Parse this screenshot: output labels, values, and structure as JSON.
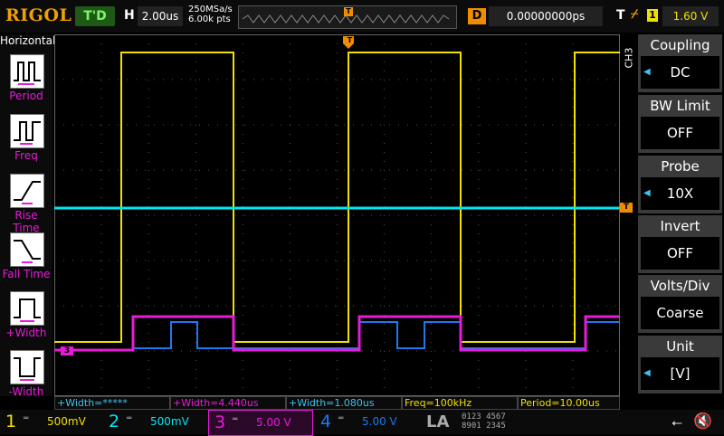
{
  "brand": "RIGOL",
  "colors": {
    "ch1": "#f0e000",
    "ch2": "#00e8f0",
    "ch3": "#e61bd8",
    "ch4": "#1e78f0",
    "trigger": "#f08c00",
    "run_state_bg": "#1e5a16"
  },
  "header": {
    "run_state": "T'D",
    "horizontal_label": "H",
    "timebase": "2.00us",
    "sample_rate": "250MSa/s",
    "memory_depth": "6.00k pts",
    "delay_label": "D",
    "delay_value": "0.00000000ps",
    "trigger_label": "T",
    "trigger_edge_icon": "rising-edge-icon",
    "trigger_source": "1",
    "trigger_level": "1.60 V"
  },
  "left_menu": {
    "title": "Horizontal",
    "items": [
      {
        "label": "Period",
        "icon": "period-icon"
      },
      {
        "label": "Freq",
        "icon": "frequency-icon"
      },
      {
        "label": "Rise Time",
        "icon": "rise-time-icon"
      },
      {
        "label": "Fall Time",
        "icon": "fall-time-icon"
      },
      {
        "label": "+Width",
        "icon": "positive-width-icon"
      },
      {
        "label": "-Width",
        "icon": "negative-width-icon"
      }
    ]
  },
  "right_menu": {
    "channel_tag": "CH3",
    "items": [
      {
        "label": "Coupling",
        "value": "DC"
      },
      {
        "label": "BW Limit",
        "value": "OFF"
      },
      {
        "label": "Probe",
        "value": "10X"
      },
      {
        "label": "Invert",
        "value": "OFF"
      },
      {
        "label": "Volts/Div",
        "value": "Coarse"
      },
      {
        "label": "Unit",
        "value": "[V]"
      }
    ]
  },
  "measurements": [
    {
      "text": "+Width=*****",
      "color": "#3cc2f0"
    },
    {
      "text": "+Width=4.440us",
      "color": "#e61bd8"
    },
    {
      "text": "+Width=1.080us",
      "color": "#3cc2f0"
    },
    {
      "text": "Freq=100kHz",
      "color": "#f0e000"
    },
    {
      "text": "Period=10.00us",
      "color": "#f0e000"
    }
  ],
  "channels": [
    {
      "num": "1",
      "coupling": "═",
      "scale": "500mV",
      "color": "#f0e000"
    },
    {
      "num": "2",
      "coupling": "═",
      "scale": "500mV",
      "color": "#00e8f0"
    },
    {
      "num": "3",
      "coupling": "═",
      "scale": "5.00 V",
      "color": "#e61bd8"
    },
    {
      "num": "4",
      "coupling": "═",
      "scale": "5.00 V",
      "color": "#1e78f0"
    }
  ],
  "logic_analyzer": {
    "label": "LA",
    "bits_row1": "0123 4567",
    "bits_row2": "8901 2345"
  },
  "markers": {
    "trigger_pos": "T",
    "ch3_ground": "3"
  }
}
